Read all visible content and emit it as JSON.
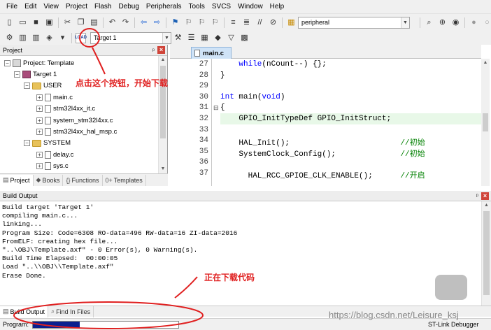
{
  "menu": [
    "File",
    "Edit",
    "View",
    "Project",
    "Flash",
    "Debug",
    "Peripherals",
    "Tools",
    "SVCS",
    "Window",
    "Help"
  ],
  "toolbar": {
    "find_value": "peripheral",
    "download_icon_label": "LOAD",
    "target_value": "Target 1"
  },
  "project_panel": {
    "title": "Project",
    "tree": [
      {
        "label": "Project: Template",
        "type": "project",
        "level": 0,
        "expanded": true
      },
      {
        "label": "Target 1",
        "type": "target",
        "level": 1,
        "expanded": true
      },
      {
        "label": "USER",
        "type": "folder",
        "level": 2,
        "expanded": true
      },
      {
        "label": "main.c",
        "type": "file",
        "level": 3
      },
      {
        "label": "stm32l4xx_it.c",
        "type": "file",
        "level": 3
      },
      {
        "label": "system_stm32l4xx.c",
        "type": "file",
        "level": 3
      },
      {
        "label": "stm32l4xx_hal_msp.c",
        "type": "file",
        "level": 3
      },
      {
        "label": "SYSTEM",
        "type": "folder",
        "level": 2,
        "expanded": true
      },
      {
        "label": "delay.c",
        "type": "file",
        "level": 3
      },
      {
        "label": "sys.c",
        "type": "file",
        "level": 3
      }
    ],
    "tabs": [
      "Project",
      "Books",
      "Functions",
      "Templates"
    ]
  },
  "editor": {
    "tab": "main.c",
    "lines": [
      {
        "num": "27",
        "code": "    while(nCount--) {};"
      },
      {
        "num": "28",
        "code": "}"
      },
      {
        "num": "29",
        "code": ""
      },
      {
        "num": "30",
        "code": "int main(void)"
      },
      {
        "num": "31",
        "code": "{"
      },
      {
        "num": "32",
        "code": "    GPIO_InitTypeDef GPIO_InitStruct;"
      },
      {
        "num": "33",
        "code": ""
      },
      {
        "num": "34",
        "code": "    HAL_Init();                        //初始"
      },
      {
        "num": "35",
        "code": "    SystemClock_Config();              //初始"
      },
      {
        "num": "36",
        "code": ""
      },
      {
        "num": "37",
        "code": "      HAL_RCC_GPIOE_CLK_ENABLE();      //开启"
      }
    ]
  },
  "build_output": {
    "title": "Build Output",
    "lines": [
      "Build target 'Target 1'",
      "compiling main.c...",
      "linking...",
      "Program Size: Code=6308 RO-data=496 RW-data=16 ZI-data=2016",
      "FromELF: creating hex file...",
      "\"..\\OBJ\\Template.axf\" - 0 Error(s), 0 Warning(s).",
      "Build Time Elapsed:  00:00:05",
      "Load \"..\\\\OBJ\\\\Template.axf\"",
      "Erase Done."
    ],
    "tabs": [
      "Build Output",
      "Find In Files"
    ]
  },
  "status": {
    "label": "Program:",
    "progress_text": "08000C00H",
    "progress_fraction": 0.32,
    "right": "ST-Link Debugger"
  },
  "annotations": {
    "click_hint": "点击这个按钮，开始下载",
    "downloading_hint": "正在下载代码"
  },
  "watermark": "https://blog.csdn.net/Leisure_ksj",
  "colors": {
    "annotation": "#e02020",
    "progress": "#0a1f8f",
    "keyword": "#0000ff",
    "comment": "#008000"
  }
}
